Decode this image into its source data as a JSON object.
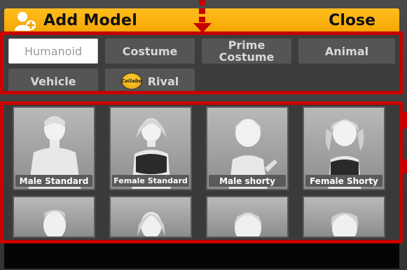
{
  "header": {
    "title": "Add Model",
    "close_label": "Close"
  },
  "tabs": [
    {
      "label": "Humanoid",
      "active": true
    },
    {
      "label": "Costume",
      "active": false
    },
    {
      "label": "Prime Costume",
      "active": false
    },
    {
      "label": "Animal",
      "active": false
    },
    {
      "label": "Vehicle",
      "active": false
    },
    {
      "label": "Rival",
      "active": false,
      "badge": "Collabo"
    }
  ],
  "models": [
    {
      "label": "Male Standard"
    },
    {
      "label": "Female Standard"
    },
    {
      "label": "Male shorty"
    },
    {
      "label": "Female Shorty"
    }
  ],
  "colors": {
    "header": "#f5a400",
    "highlight": "#c80000",
    "active_tab": "#ffffff"
  }
}
